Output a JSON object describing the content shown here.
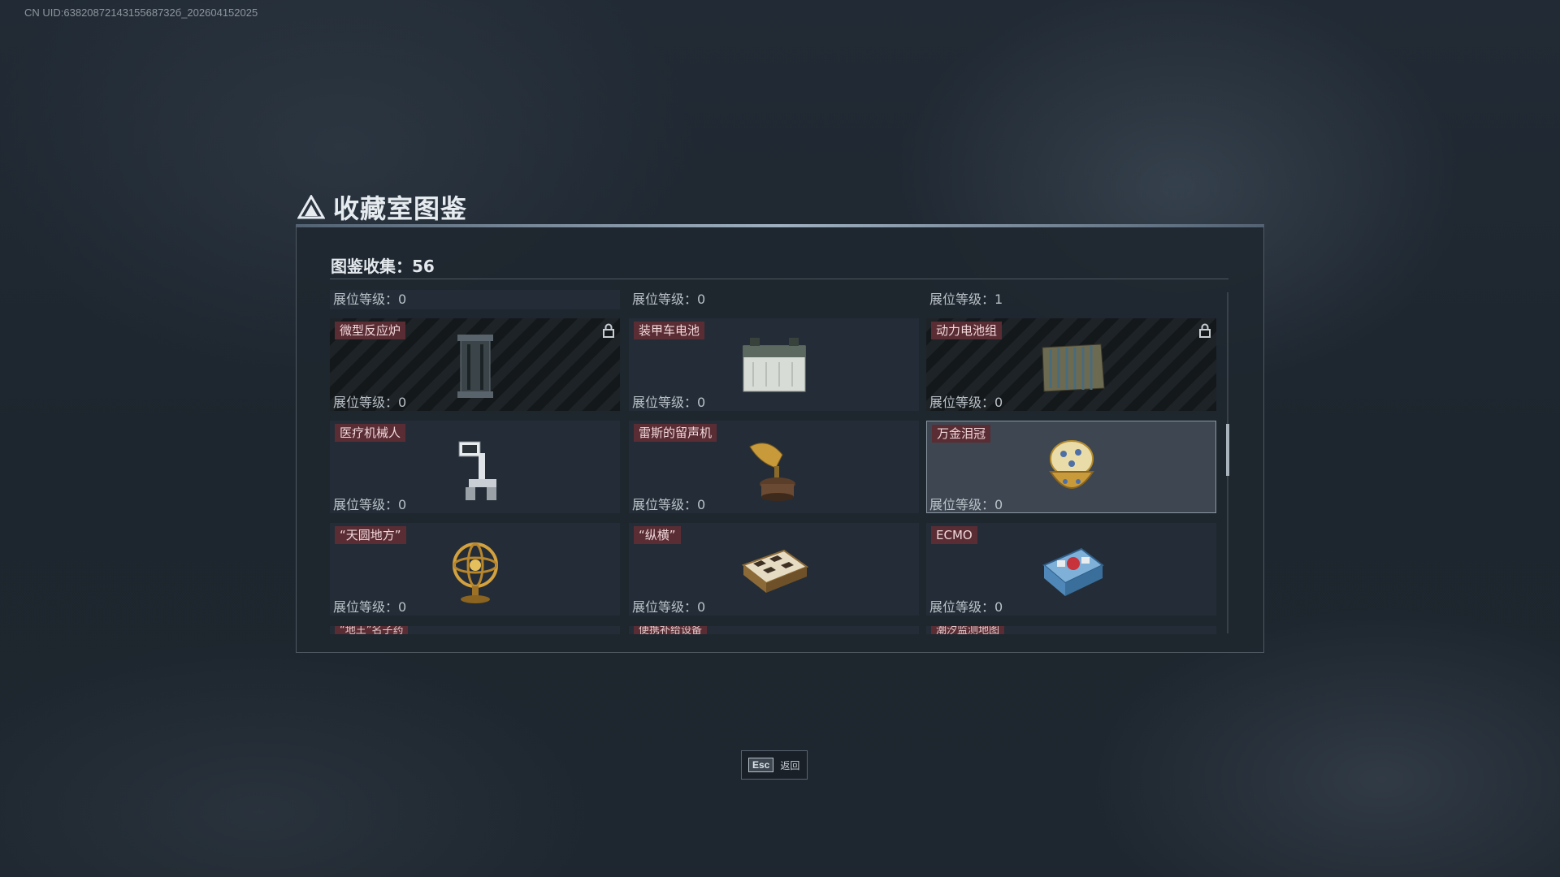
{
  "uid_text": "CN UID:6382087214315568732б_202604152025",
  "header": {
    "title": "收藏室图鉴"
  },
  "collection": {
    "count_label": "图鉴收集：56"
  },
  "top_levels": [
    "展位等级：0",
    "展位等级：0",
    "展位等级：1"
  ],
  "items": [
    {
      "name": "微型反应炉",
      "level": "展位等级：0",
      "locked": true,
      "icon": "reactor-icon"
    },
    {
      "name": "装甲车电池",
      "level": "展位等级：0",
      "locked": false,
      "icon": "battery-icon"
    },
    {
      "name": "动力电池组",
      "level": "展位等级：0",
      "locked": true,
      "icon": "battery-pack-icon"
    },
    {
      "name": "医疗机械人",
      "level": "展位等级：0",
      "locked": false,
      "icon": "medical-robot-icon"
    },
    {
      "name": "雷斯的留声机",
      "level": "展位等级：0",
      "locked": false,
      "icon": "gramophone-icon"
    },
    {
      "name": "万金泪冠",
      "level": "展位等级：0",
      "locked": false,
      "icon": "jeweled-egg-icon",
      "selected": true
    },
    {
      "name": "“天圆地方”",
      "level": "展位等级：0",
      "locked": false,
      "icon": "armillary-sphere-icon"
    },
    {
      "name": "“纵横”",
      "level": "展位等级：0",
      "locked": false,
      "icon": "chess-box-icon"
    },
    {
      "name": "ECMO",
      "level": "展位等级：0",
      "locked": false,
      "icon": "ecmo-icon"
    }
  ],
  "partial_row": [
    "“地王”名子药",
    "便携补给设备",
    "潮汐监测地图"
  ],
  "footer": {
    "key": "Esc",
    "label": "返回"
  },
  "colors": {
    "name_tag": "#5a2d34",
    "panel_border": "#8b97a3",
    "highlight": "#3d4651"
  }
}
